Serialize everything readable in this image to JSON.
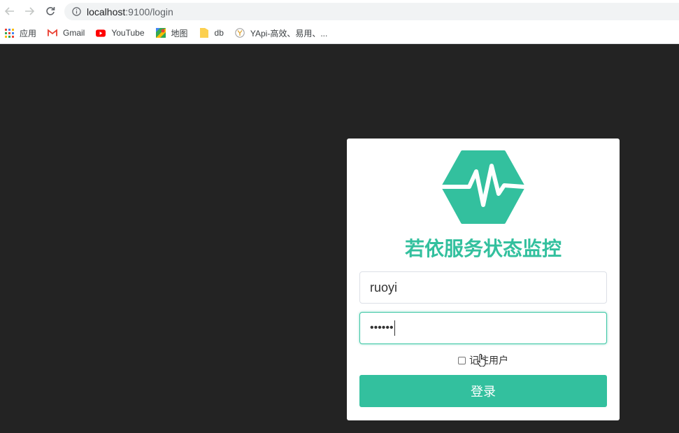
{
  "browser": {
    "back_icon": "arrow-left-icon",
    "forward_icon": "arrow-right-icon",
    "reload_icon": "reload-icon",
    "url_host": "localhost",
    "url_rest": ":9100/login",
    "bookmarks": [
      {
        "label": "应用",
        "icon": "apps-grid-icon"
      },
      {
        "label": "Gmail",
        "icon": "gmail-icon"
      },
      {
        "label": "YouTube",
        "icon": "youtube-icon"
      },
      {
        "label": "地图",
        "icon": "maps-icon"
      },
      {
        "label": "db",
        "icon": "folder-icon"
      },
      {
        "label": "YApi-高效、易用、...",
        "icon": "yapi-icon"
      }
    ]
  },
  "login": {
    "title": "若依服务状态监控",
    "username_value": "ruoyi",
    "password_value": "••••••",
    "remember_label": "记住用户",
    "submit_label": "登录"
  },
  "colors": {
    "accent": "#33c09e",
    "page_background": "#232323",
    "card_background": "#ffffff"
  }
}
